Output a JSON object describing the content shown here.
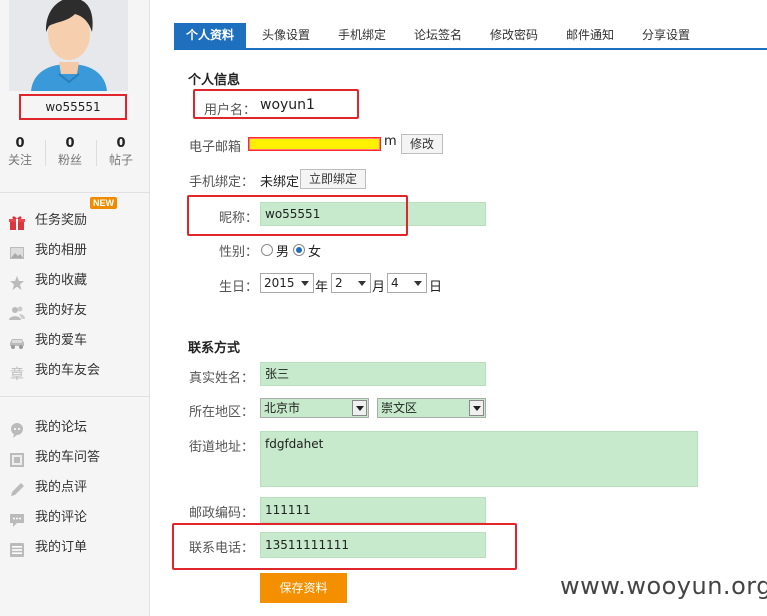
{
  "profile": {
    "username_display": "wo55551",
    "stats": [
      {
        "num": "0",
        "label": "关注"
      },
      {
        "num": "0",
        "label": "粉丝"
      },
      {
        "num": "0",
        "label": "帖子"
      }
    ]
  },
  "sidebar": {
    "new_badge": "NEW",
    "items": [
      {
        "label": "任务奖励",
        "icon": "gift-icon"
      },
      {
        "label": "我的相册",
        "icon": "photo-icon"
      },
      {
        "label": "我的收藏",
        "icon": "star-icon"
      },
      {
        "label": "我的好友",
        "icon": "friends-icon"
      },
      {
        "label": "我的爱车",
        "icon": "car-icon"
      },
      {
        "label": "我的车友会",
        "icon": "club-icon"
      },
      {
        "label": "我的论坛",
        "icon": "forum-icon"
      },
      {
        "label": "我的车问答",
        "icon": "qa-icon"
      },
      {
        "label": "我的点评",
        "icon": "pen-icon"
      },
      {
        "label": "我的评论",
        "icon": "comment-icon"
      },
      {
        "label": "我的订单",
        "icon": "order-icon"
      }
    ]
  },
  "tabs": [
    {
      "label": "个人资料",
      "active": true
    },
    {
      "label": "头像设置"
    },
    {
      "label": "手机绑定"
    },
    {
      "label": "论坛签名"
    },
    {
      "label": "修改密码"
    },
    {
      "label": "邮件通知"
    },
    {
      "label": "分享设置"
    }
  ],
  "personal": {
    "section_title": "个人信息",
    "username_label": "用户名：",
    "username_value": "woyun1",
    "email_label": "电子邮箱",
    "email_suffix": "m",
    "email_edit_button": "修改",
    "phone_label": "手机绑定：",
    "phone_status": "未绑定",
    "phone_bind_button": "立即绑定",
    "nickname_label": "昵称：",
    "nickname_value": "wo55551",
    "gender_label": "性别：",
    "gender_male": "男",
    "gender_female": "女",
    "gender_selected": "女",
    "birthday_label": "生日：",
    "birthday_year": "2015",
    "year_unit": "年",
    "birthday_month": "2",
    "month_unit": "月",
    "birthday_day": "4",
    "day_unit": "日"
  },
  "contact": {
    "section_title": "联系方式",
    "realname_label": "真实姓名：",
    "realname_value": "张三",
    "region_label": "所在地区：",
    "province_value": "北京市",
    "district_value": "崇文区",
    "street_label": "街道地址：",
    "street_value": "fdgfdahet",
    "zip_label": "邮政编码：",
    "zip_value": "111111",
    "tel_label": "联系电话：",
    "tel_value": "13511111111"
  },
  "save_button": "保存资料",
  "watermark": "www.wooyun.org",
  "colors": {
    "accent": "#1e6fbd",
    "input_bg": "#c6eacb",
    "save_button_bg": "#f49000",
    "highlight_border": "#e0262a",
    "new_badge": "#f08a00"
  }
}
